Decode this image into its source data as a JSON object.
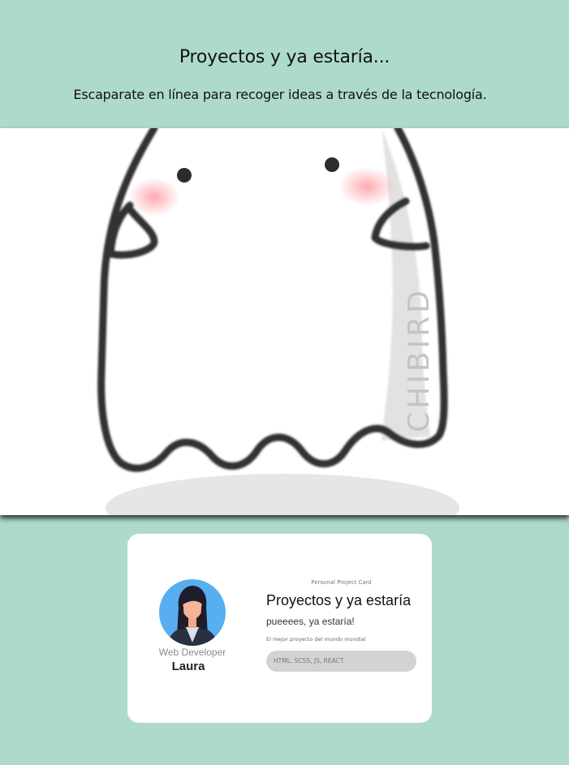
{
  "header": {
    "title": "Proyectos y ya estaría...",
    "subtitle": "Escaparate en línea para recoger ideas a través de la tecnología."
  },
  "banner": {
    "image": "ghost-illustration",
    "watermark": "CHIBIRD"
  },
  "card": {
    "avatar_icon": "woman-avatar-icon",
    "role": "Web Developer",
    "name": "Laura",
    "label": "Personal Project Card",
    "title": "Proyectos y ya estaría",
    "text": "pueeees, ya estaría!",
    "description": "El mejor proyecto del mundo mundial",
    "tech": "HTML, SCSS, JS, REACT"
  },
  "colors": {
    "background": "#aedacd",
    "card": "#ffffff",
    "avatar_bg": "#57aef0",
    "pill": "#d3d3d3"
  }
}
